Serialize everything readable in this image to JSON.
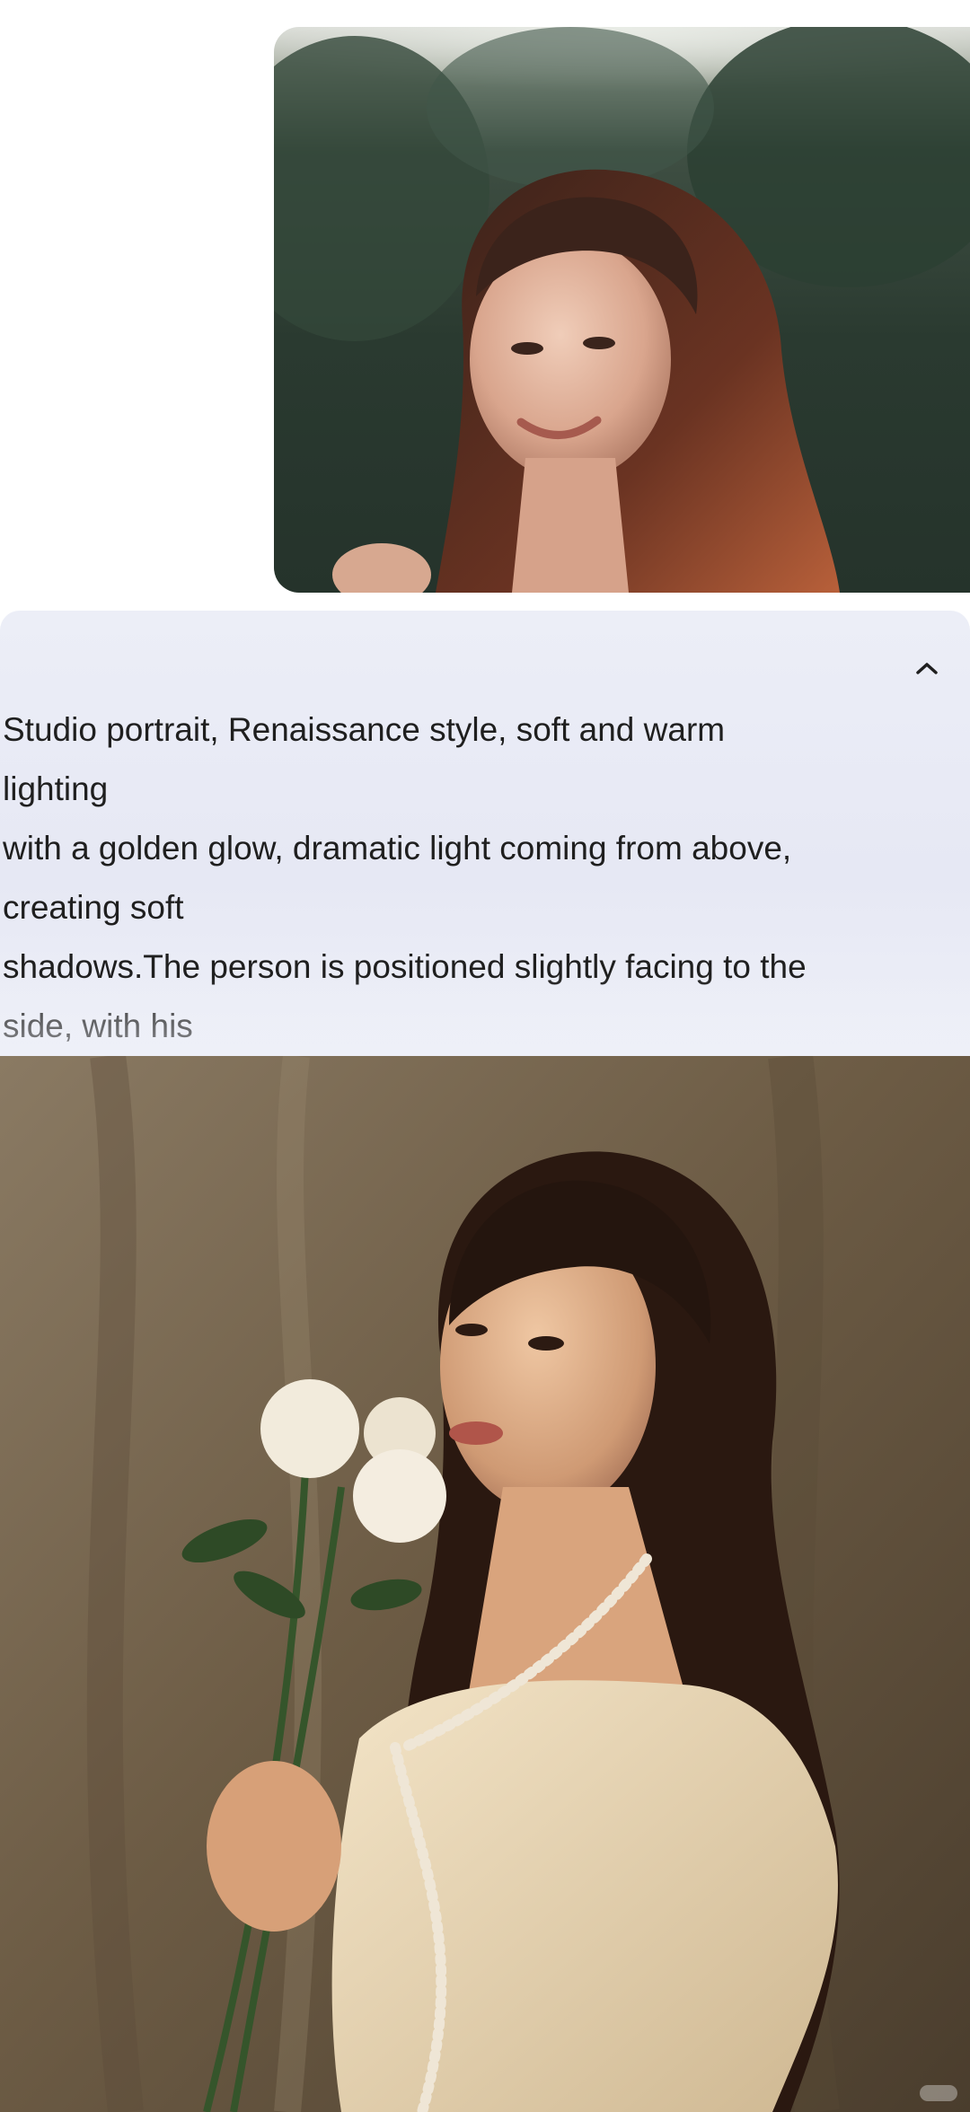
{
  "conversation": {
    "user_photo": {
      "icon": "photo-portrait-smiling-woman"
    },
    "prompt": {
      "text": "Studio portrait, Renaissance style, soft and warm\nlighting\nwith a golden glow, dramatic light coming from above,\ncreating soft\nshadows.The person is positioned slightly facing to the\nside, with his",
      "collapse_icon": "chevron-up-icon"
    },
    "generated_photo": {
      "icon": "photo-renaissance-portrait-with-roses"
    }
  },
  "colors": {
    "panel_bg": "#e9ebf6",
    "text": "#1f1f1f",
    "backdrop": "#6b5b45"
  }
}
